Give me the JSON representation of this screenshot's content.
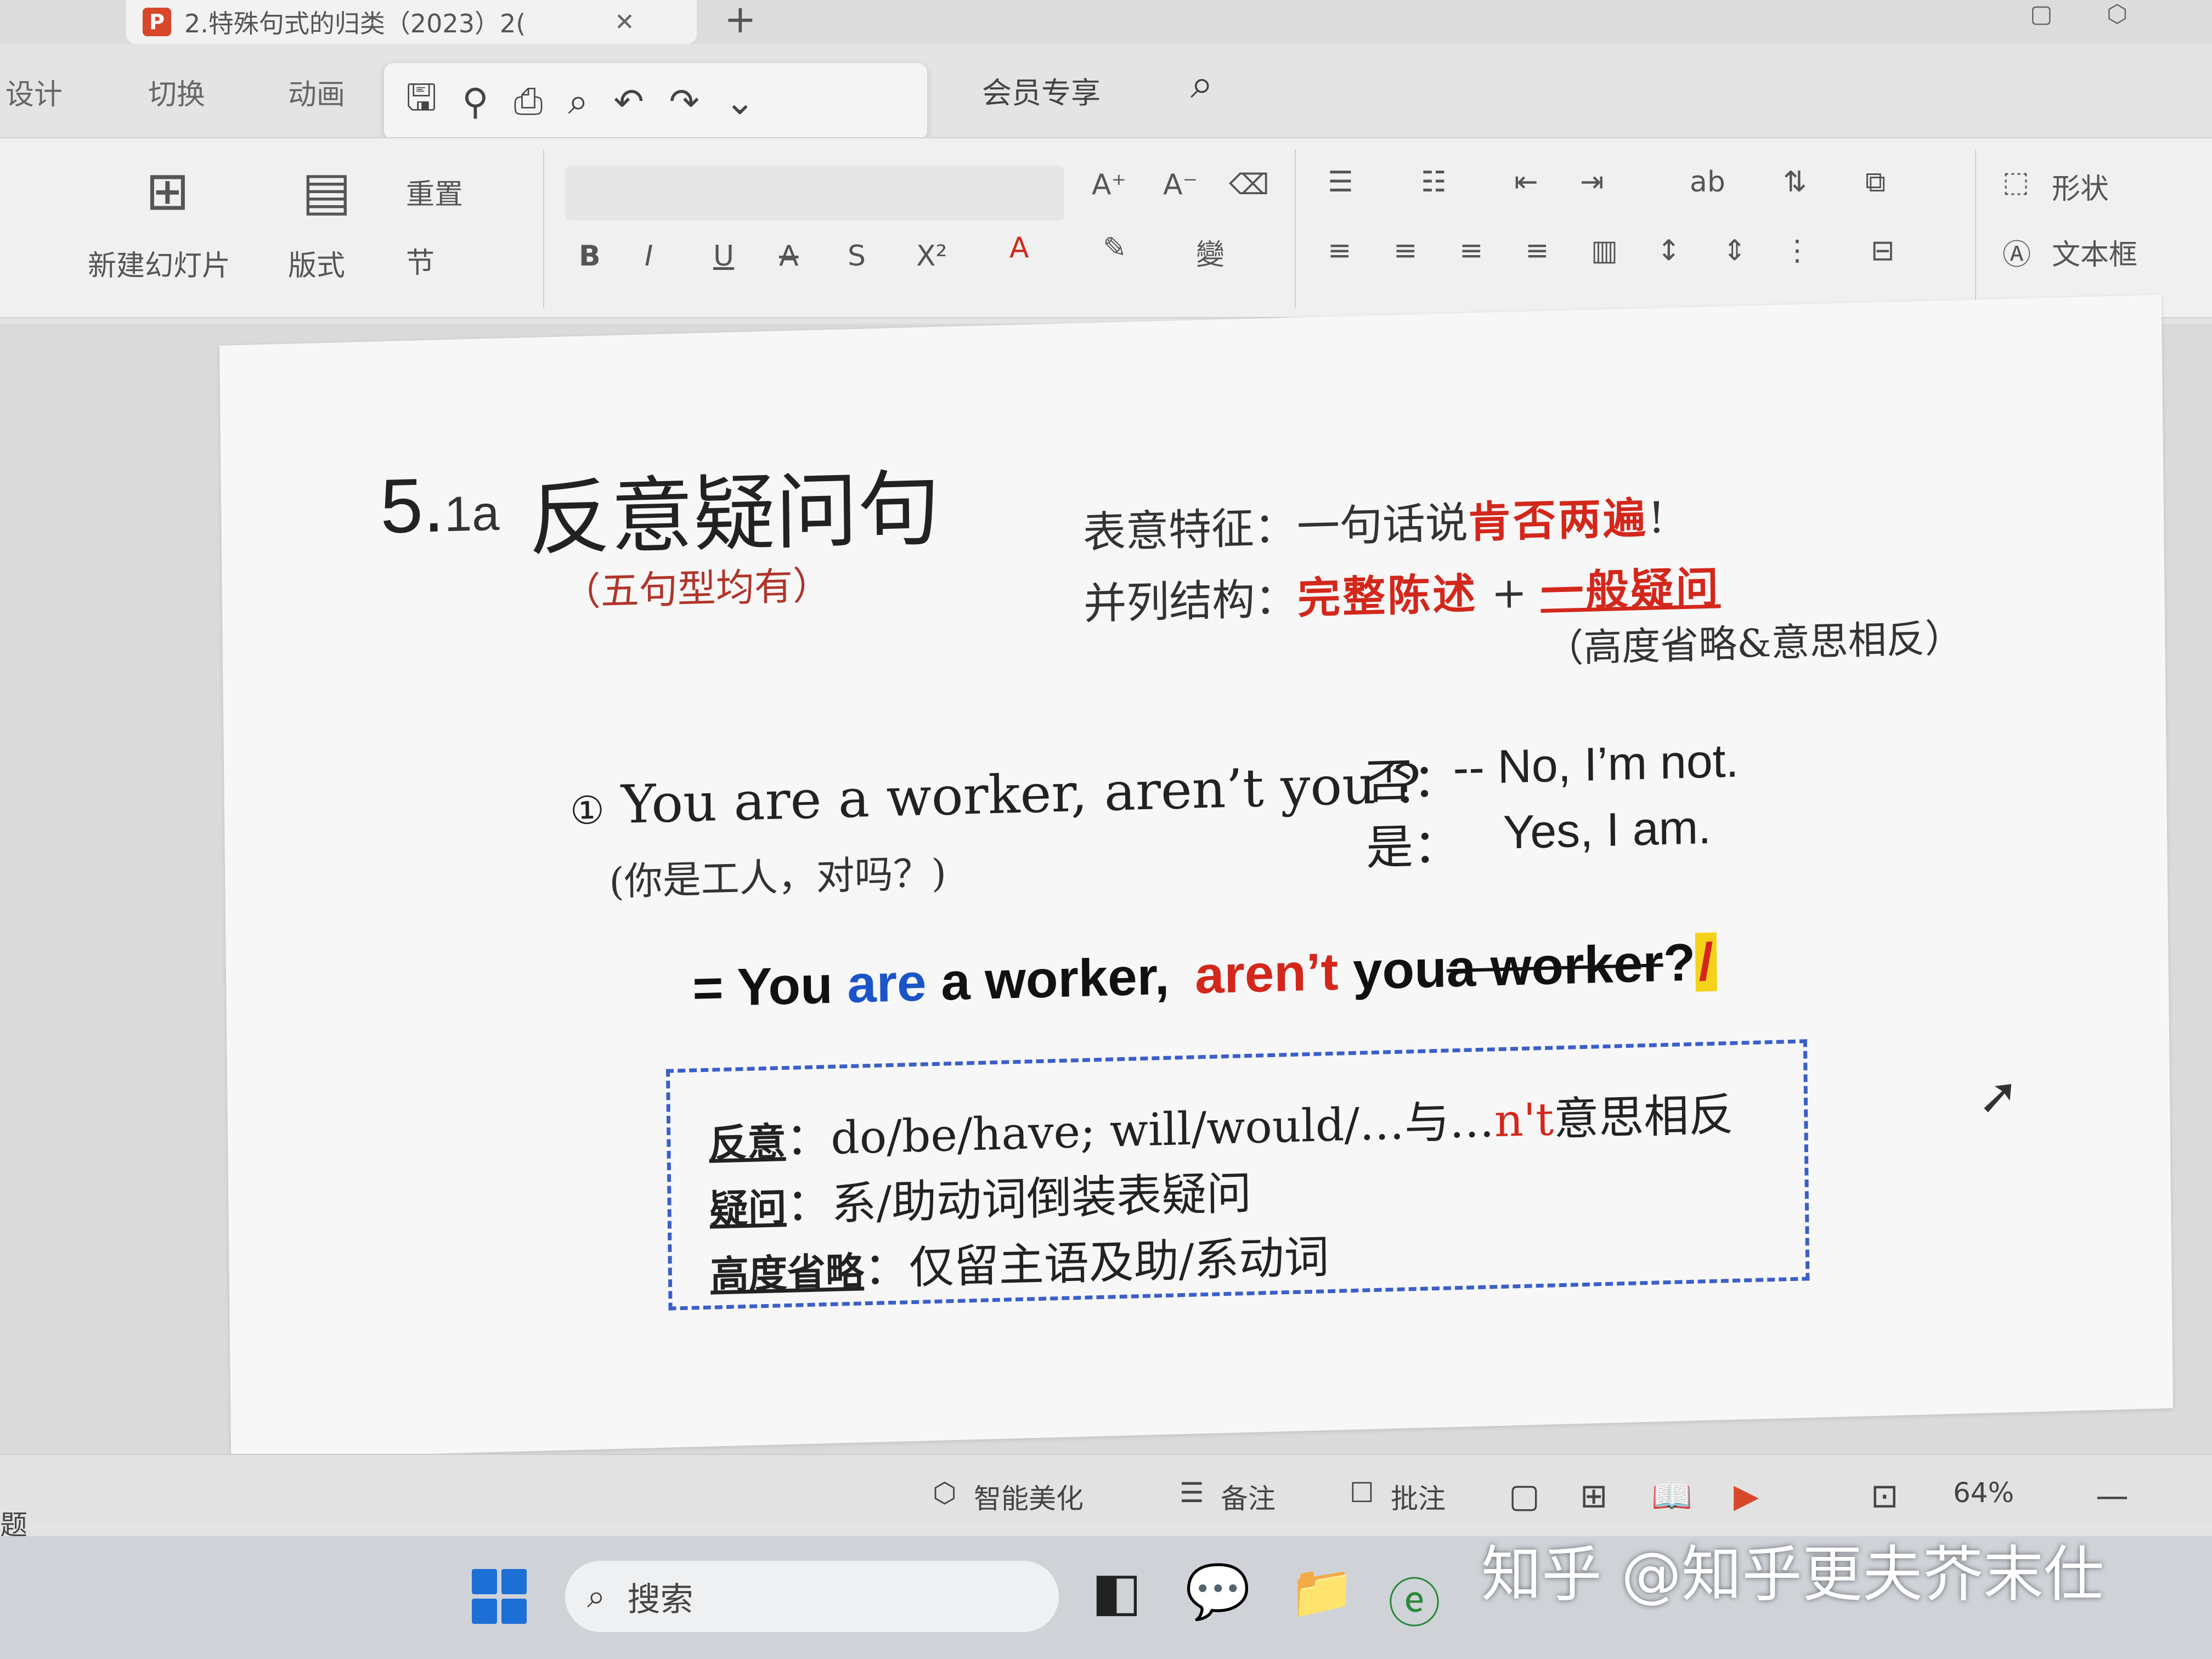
{
  "titlebar": {
    "doc_title": "2.特殊句式的归类（2023）2(",
    "tab_close": "✕",
    "new_tab": "+"
  },
  "menu": {
    "items": [
      "设计",
      "切换",
      "动画"
    ],
    "vip": "会员专享"
  },
  "ribbon": {
    "new_slide": "新建幻灯片",
    "layout": "版式",
    "reset": "重置",
    "section": "节",
    "shape": "形状",
    "textbox": "文本框",
    "format_buttons": [
      "B",
      "I",
      "U",
      "A",
      "S",
      "X²"
    ]
  },
  "slide": {
    "title_num": "5.",
    "title_sub": "1a",
    "title": "反意疑问句",
    "subtitle": "（五句型均有）",
    "feature_label": "表意特征：",
    "feature_text": "一句话说",
    "feature_red": "肯否两遍",
    "feature_end": "!",
    "structure_label": "并列结构：",
    "structure_red1": "完整陈述",
    "structure_plus": "+",
    "structure_red2": "一般疑问",
    "structure_note": "（高度省略&意思相反）",
    "example_num": "①",
    "example_en": "You are a worker, aren’t you ?",
    "example_cn": "(你是工人，对吗？)",
    "neg_label": "否：",
    "neg_answer": "-- No, I’m not.",
    "pos_label": "是：",
    "pos_answer": "Yes, I am.",
    "eq_prefix": "= You",
    "eq_are": "are",
    "eq_mid": "a worker,",
    "eq_arent": "aren’t",
    "eq_you": "you",
    "eq_strike": "a worker",
    "eq_q": "?",
    "eq_slash": "/",
    "box": {
      "l1_label": "反意",
      "l1_text": "：do/be/have; will/would/…与…",
      "l1_red": "n't",
      "l1_end": "意思相反",
      "l2_label": "疑问",
      "l2_text": "：系/助动词倒装表疑问",
      "l3_label": "高度省略",
      "l3_text": "：仅留主语及助/系动词"
    }
  },
  "statusbar": {
    "beautify": "智能美化",
    "notes": "备注",
    "comment": "批注",
    "zoom": "64%",
    "left_stub": "题"
  },
  "taskbar": {
    "search_label": "搜索"
  },
  "watermark": "知乎 @知乎更夫芥末仕"
}
